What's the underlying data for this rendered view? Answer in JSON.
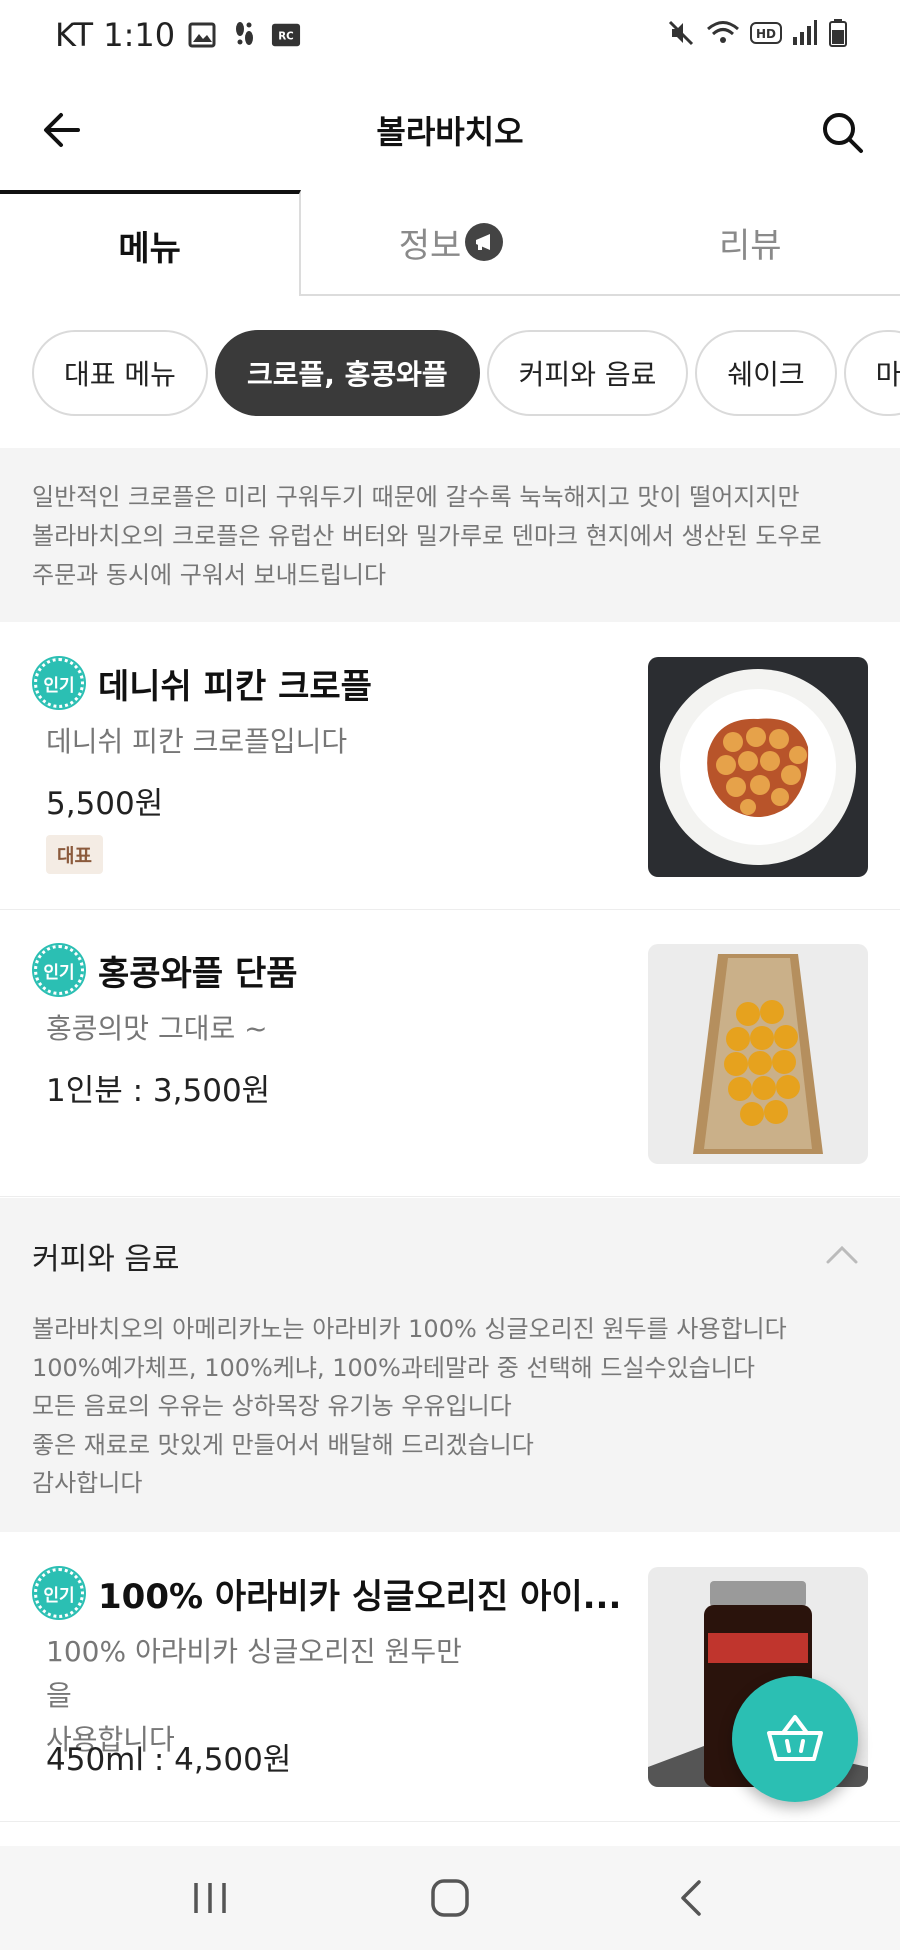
{
  "status_bar": {
    "carrier_time": "KT 1:10",
    "icons": [
      "gallery-icon",
      "footprint-icon",
      "rc-icon",
      "mute-icon",
      "wifi-icon",
      "hd-icon",
      "signal-icon",
      "battery-icon"
    ],
    "hd_label": "HD",
    "rc_label": "RC"
  },
  "app_bar": {
    "title": "볼라바치오",
    "back_icon": "back-arrow-icon",
    "search_icon": "search-icon"
  },
  "tabs": [
    {
      "label": "메뉴",
      "active": true
    },
    {
      "label": "정보",
      "active": false,
      "badge_icon": "megaphone-icon"
    },
    {
      "label": "리뷰",
      "active": false
    }
  ],
  "chips": [
    {
      "label": "대표 메뉴",
      "active": false
    },
    {
      "label": "크로플, 홍콩와플",
      "active": true
    },
    {
      "label": "커피와 음료",
      "active": false
    },
    {
      "label": "쉐이크",
      "active": false
    },
    {
      "label": "마",
      "active": false
    }
  ],
  "category_desc": {
    "lines": [
      "일반적인 크로플은 미리 구워두기 때문에 갈수록 눅눅해지고 맛이 떨어지지만",
      "볼라바치오의 크로플은 유럽산 버터와 밀가루로 덴마크 현지에서 생산된 도우로",
      "주문과 동시에 구워서 보내드립니다"
    ]
  },
  "menu_items": [
    {
      "badge": "인기",
      "name": "데니쉬 피칸 크로플",
      "desc_lines": [
        "데니쉬 피칸 크로플입니다"
      ],
      "price": "5,500원",
      "tag": "대표",
      "image_icon": "croffle-photo"
    },
    {
      "badge": "인기",
      "name": "홍콩와플 단품",
      "desc_lines": [
        "홍콩의맛 그대로 ~"
      ],
      "price": "1인분 : 3,500원",
      "image_icon": "egg-waffle-photo"
    },
    {
      "badge": "인기",
      "name": "100% 아라비카 싱글오리진 아이...",
      "desc_lines": [
        "100% 아라비카 싱글오리진 원두만을",
        "사용합니다"
      ],
      "price": "450ml : 4,500원",
      "image_icon": "coffee-bottle-photo"
    }
  ],
  "section_coffee": {
    "title": "커피와 음료",
    "chevron_icon": "chevron-up-icon",
    "lines": [
      "볼라바치오의 아메리카노는 아라비카 100% 싱글오리진 원두를 사용합니다",
      "100%예가체프, 100%케냐, 100%과테말라 중 선택해 드실수있습니다",
      "모든 음료의 우유는 상하목장 유기농 우유입니다",
      "좋은 재료로 맛있게 만들어서 배달해 드리겠습니다",
      "감사합니다"
    ]
  },
  "cart_fab": {
    "icon": "basket-icon"
  },
  "nav_bar": {
    "icons": [
      "recent-apps-icon",
      "home-icon",
      "back-icon"
    ]
  },
  "colors": {
    "accent": "#2bbfb3",
    "chip_active": "#3a3a3a",
    "tag_bg": "#f4ece4",
    "tag_text": "#8b5a3c"
  }
}
